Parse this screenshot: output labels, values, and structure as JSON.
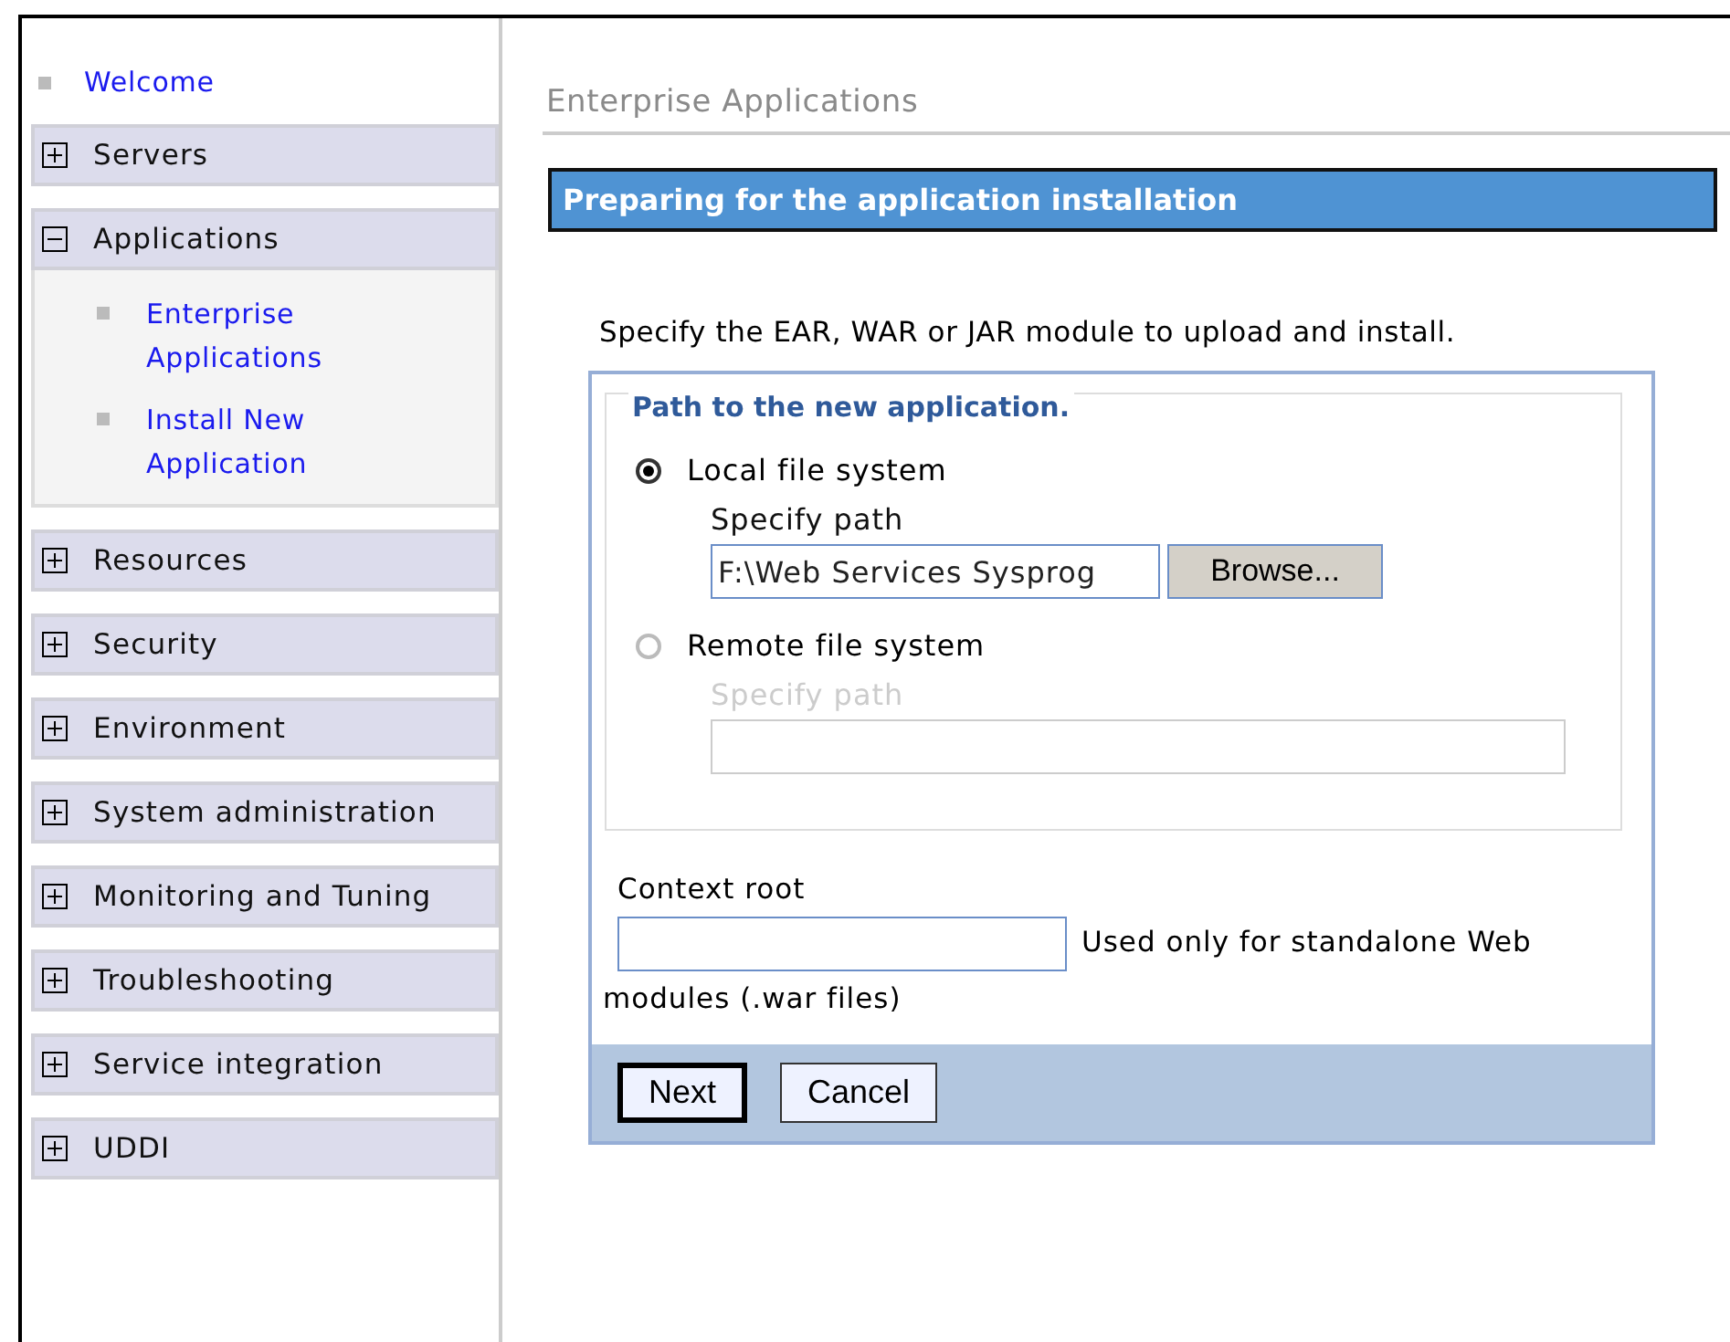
{
  "sidebar": {
    "welcome": "Welcome",
    "sections": [
      {
        "label": "Servers",
        "expanded": false
      },
      {
        "label": "Applications",
        "expanded": true,
        "children": [
          "Enterprise Applications",
          "Install New Application"
        ]
      },
      {
        "label": "Resources",
        "expanded": false
      },
      {
        "label": "Security",
        "expanded": false
      },
      {
        "label": "Environment",
        "expanded": false
      },
      {
        "label": "System administration",
        "expanded": false
      },
      {
        "label": "Monitoring and Tuning",
        "expanded": false
      },
      {
        "label": "Troubleshooting",
        "expanded": false
      },
      {
        "label": "Service integration",
        "expanded": false
      },
      {
        "label": "UDDI",
        "expanded": false
      }
    ]
  },
  "main": {
    "page_title": "Enterprise Applications",
    "panel_title": "Preparing for the application installation",
    "instruction": "Specify the EAR, WAR or JAR module to upload and install.",
    "legend": "Path to the new application.",
    "sources": [
      {
        "label": "Local file system",
        "selected": true,
        "path_label": "Specify path",
        "value": "F:\\Web Services Sysprog",
        "button": "Browse..."
      },
      {
        "label": "Remote file system",
        "selected": false,
        "path_label": "Specify path"
      }
    ],
    "context_root_label": "Context root",
    "context_root_note": [
      "Used only for standalone Web",
      "modules (.war files)"
    ],
    "buttons": [
      {
        "label": "Next",
        "default": true
      },
      {
        "label": "Cancel",
        "default": false
      }
    ]
  }
}
